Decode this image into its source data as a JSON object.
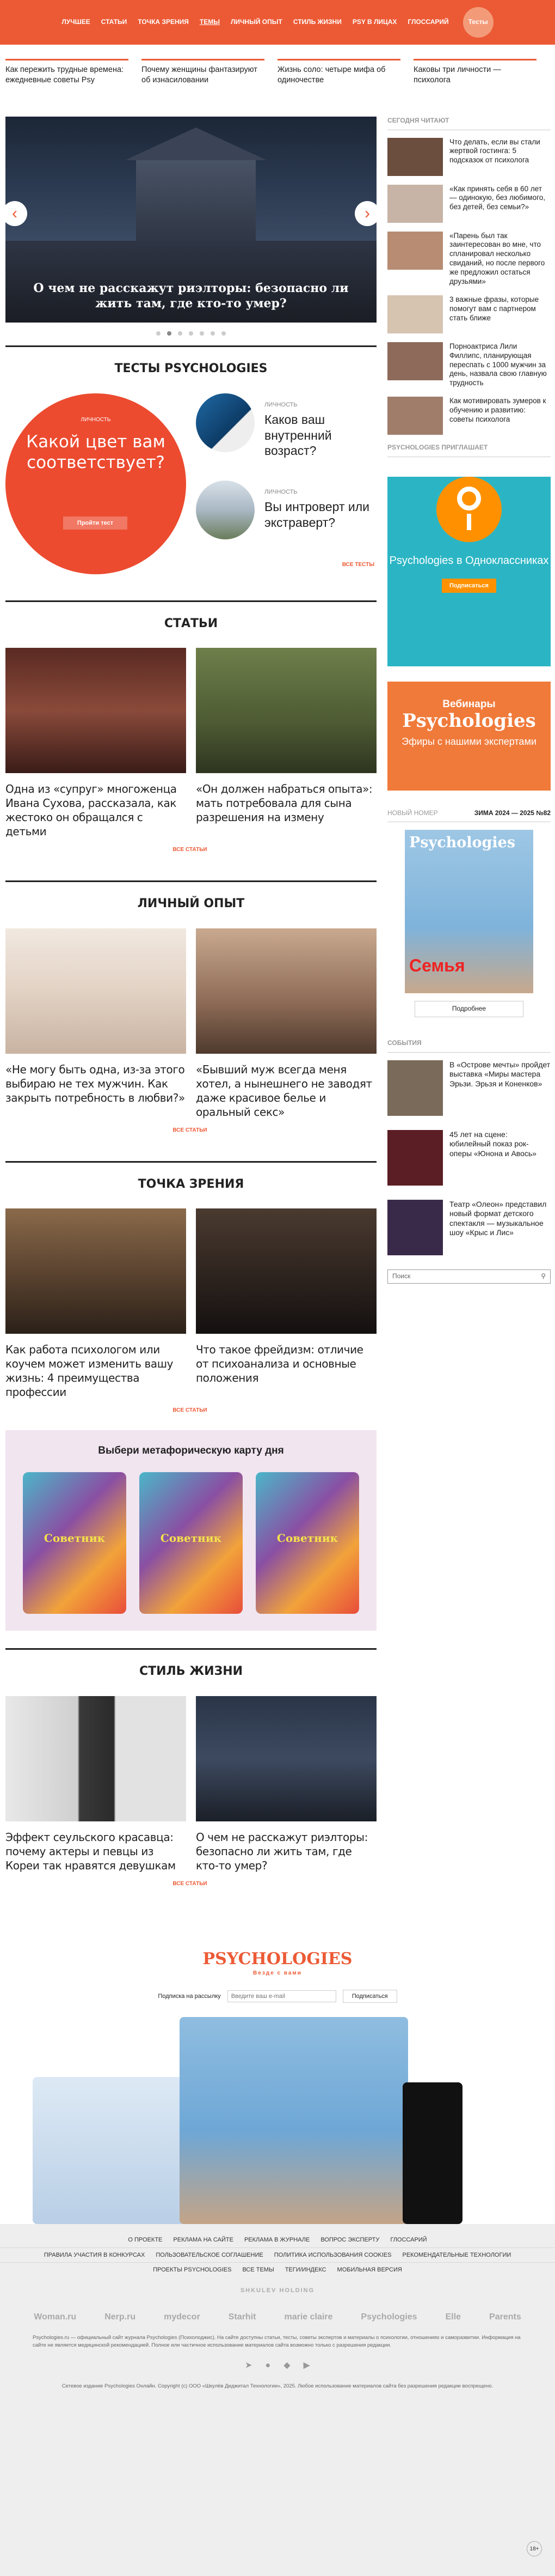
{
  "nav": {
    "items": [
      "Лучшее",
      "Статьи",
      "Точка зрения",
      "Темы",
      "Личный опыт",
      "Стиль жизни",
      "PSY в лицах",
      "Глоссарий"
    ],
    "tests_label": "Тесты"
  },
  "ticker": [
    "Как пережить трудные времена: ежедневные советы Psy",
    "Почему женщины фантазируют об изнасиловании",
    "Жизнь соло: четыре мифа об одиночестве",
    "Каковы три личности — психолога"
  ],
  "slider": {
    "caption": "О чем не расскажут риэлторы: безопасно ли жить там, где кто-то умер?",
    "dots_count": 7,
    "active_dot": 1
  },
  "tests": {
    "title": "Тесты Psychologies",
    "big": {
      "kicker": "Личность",
      "question": "Какой цвет вам соответствует?",
      "button": "Пройти тест"
    },
    "small": [
      {
        "kicker": "Личность",
        "title": "Каков ваш внутренний возраст?"
      },
      {
        "kicker": "Личность",
        "title": "Вы интроверт или экстраверт?"
      }
    ],
    "all": "Все тесты"
  },
  "articles": {
    "title": "Статьи",
    "items": [
      "Одна из «супруг» многоженца Ивана Сухова, рассказала, как жестоко он обращался с детьми",
      "«Он должен набраться опыта»: мать потребовала для сына разрешения на измену"
    ],
    "all": "Все статьи"
  },
  "personal": {
    "title": "Личный опыт",
    "items": [
      "«Не могу быть одна, из-за этого выбираю не тех мужчин. Как закрыть потребность в любви?»",
      "«Бывший муж всегда меня хотел, а нынешнего не заводят даже красивое белье и оральный секс»"
    ],
    "all": "Все статьи"
  },
  "viewpoint": {
    "title": "Точка зрения",
    "items": [
      "Как работа психологом или коучем может изменить вашу жизнь: 4 преимущества профессии",
      "Что такое фрейдизм: отличие от психоанализа и основные положения"
    ],
    "all": "Все статьи"
  },
  "meta_cards": {
    "title": "Выбери метафорическую карту дня",
    "card_label": "Советник"
  },
  "lifestyle": {
    "title": "Стиль жизни",
    "items": [
      "Эффект сеульского красавца: почему актеры и певцы из Кореи так нравятся девушкам",
      "О чем не расскажут риэлторы: безопасно ли жить там, где кто-то умер?"
    ],
    "all": "Все статьи"
  },
  "sidebar": {
    "popular_title": "Сегодня читают",
    "popular": [
      "Что делать, если вы стали жертвой гостинга: 5 подсказок от психолога",
      "«Как принять себя в 60 лет — одинокую, без любимого, без детей, без семьи?»",
      "«Парень был так заинтересован во мне, что спланировал несколько свиданий, но после первого же предложил остаться друзьями»",
      "3 важные фразы, которые помогут вам с партнером стать ближе",
      "Порноактриса Лили Филлипс, планирующая переспать с 1000 мужчин за день, назвала свою главную трудность",
      "Как мотивировать зумеров к обучению и развитию: советы психолога"
    ],
    "invites_title": "Psychologies приглашает",
    "ok": {
      "title": "Psychologies в Одноклассниках",
      "button": "Подписаться"
    },
    "webinar": {
      "a": "Вебинары",
      "b": "Psychologies",
      "c": "Эфиры с нашими экспертами"
    },
    "issue": {
      "label": "Новый номер",
      "value": "Зима 2024 — 2025 №82",
      "button": "Подробнее",
      "cover_title": "Psychologies",
      "cover_word": "Семья"
    },
    "events_title": "События",
    "events": [
      "В «Острове мечты» пройдет выставка «Миры мастера Эрьзи. Эрьзя и Коненков»",
      "45 лет на сцене: юбилейный показ рок-оперы «Юнона и Авось»",
      "Театр «Олеон» представил новый формат детского спектакля — музыкальное шоу «Крыс и Лис»"
    ],
    "search_placeholder": "Поиск"
  },
  "subscribe": {
    "logo": "Psychologies",
    "tagline": "Везде с вами",
    "label": "Подписка на рассылку",
    "placeholder": "Введите ваш e-mail",
    "button": "Подписаться"
  },
  "footer": {
    "row1": [
      "О проекте",
      "Реклама на сайте",
      "Реклама в журнале",
      "Вопрос эксперту",
      "Глоссарий"
    ],
    "row2": [
      "Правила участия в конкурсах",
      "Пользовательское соглашение",
      "Политика использования cookies",
      "Рекомендательные технологии"
    ],
    "row3": [
      "Проекты Psychologies",
      "Все темы",
      "Теги/индекс",
      "Мобильная версия"
    ],
    "holding": "Shkulev holding",
    "brands": [
      "Woman.ru",
      "Nerp.ru",
      "mydecor",
      "Starhit",
      "marie claire",
      "Psychologies",
      "Elle",
      "Parents"
    ],
    "legal": "Psychologies.ru — официальный сайт журнала Psychologies (Психолоджис). На сайте доступны статьи, тесты, советы экспертов и материалы о психологии, отношениях и саморазвитии. Информация на сайте не является медицинской рекомендацией. Полное или частичное использование материалов сайта возможно только с разрешения редакции.",
    "copyright": "Сетевое издание Psychologies Онлайн. Copyright (c) ООО «Шкулёв Диджитал Технологии», 2025. Любое использование материалов сайта без разрешения редакции воспрещено.",
    "age": "18+"
  }
}
